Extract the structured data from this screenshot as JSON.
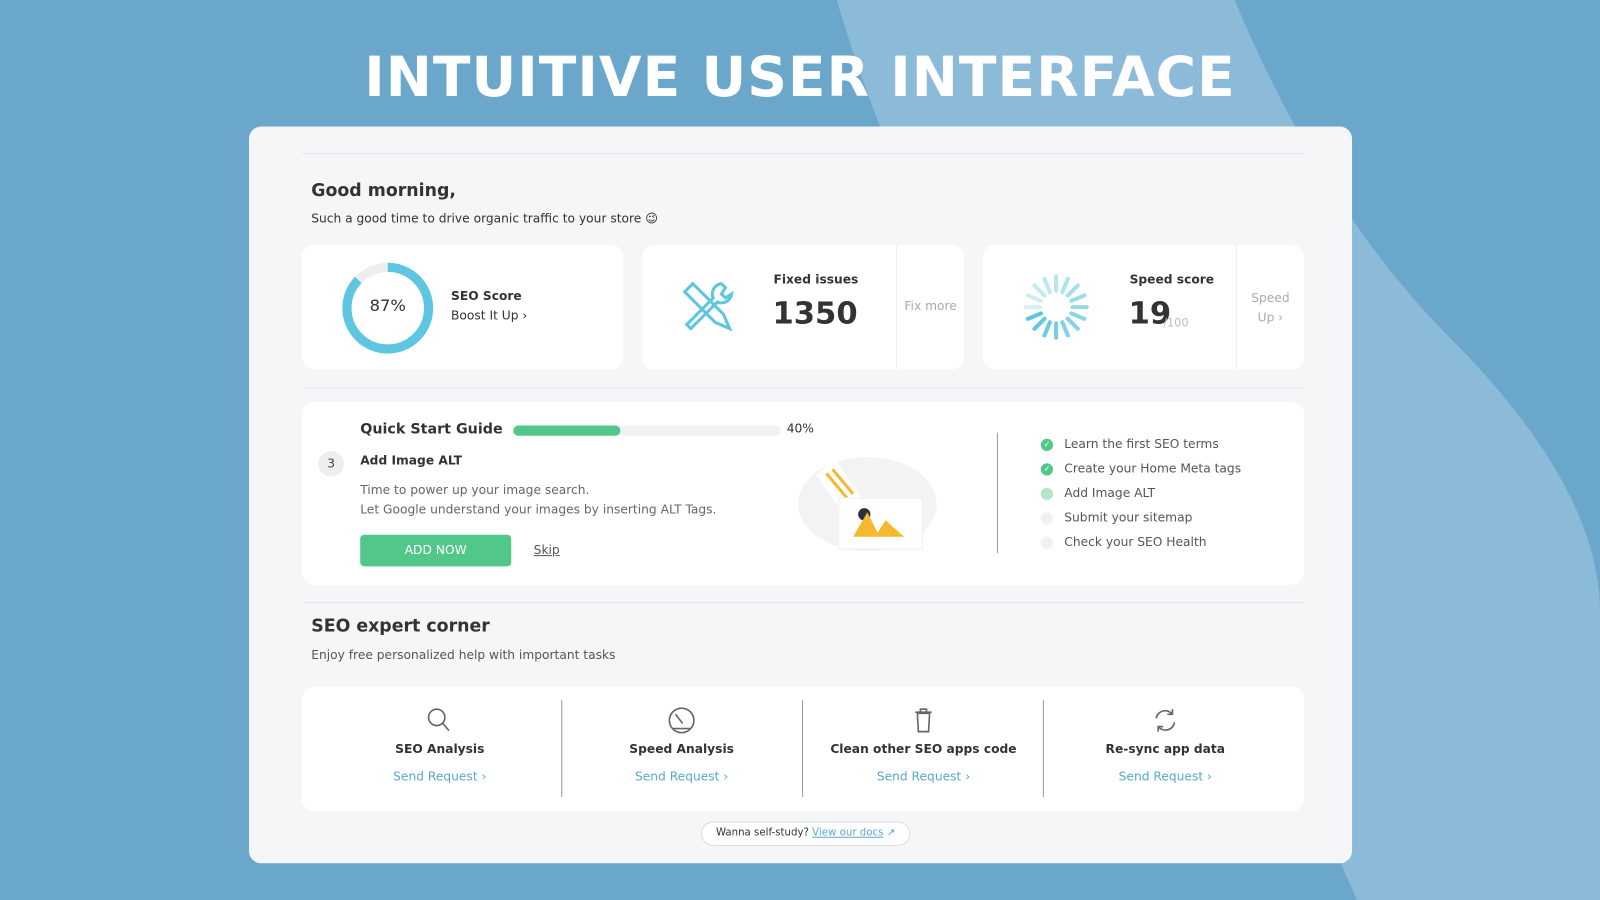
{
  "headline": "INTUITIVE USER INTERFACE",
  "greeting": {
    "title": "Good morning,",
    "subtitle": "Such a good time to drive organic traffic to your store 😉"
  },
  "seo_score": {
    "value": "87%",
    "percent": 87,
    "label": "SEO Score",
    "link": "Boost It Up ›"
  },
  "fixed_issues": {
    "label": "Fixed issues",
    "value": "1350",
    "action": "Fix more"
  },
  "speed_score": {
    "label": "Speed score",
    "value": "19",
    "max": "/100",
    "action_line1": "Speed",
    "action_line2": "Up ›"
  },
  "quick_start": {
    "title": "Quick Start Guide",
    "progress_label": "40%",
    "progress": 40,
    "step_number": "3",
    "step_title": "Add Image ALT",
    "desc_line1": "Time to power up your image search.",
    "desc_line2": "Let Google understand your images by inserting ALT Tags.",
    "add_button": "ADD NOW",
    "skip": "Skip",
    "checklist": [
      {
        "label": "Learn the first SEO terms",
        "status": "done"
      },
      {
        "label": "Create your Home Meta tags",
        "status": "done"
      },
      {
        "label": "Add Image ALT",
        "status": "current"
      },
      {
        "label": "Submit your sitemap",
        "status": "todo"
      },
      {
        "label": "Check your SEO Health",
        "status": "todo"
      }
    ]
  },
  "expert": {
    "title": "SEO expert corner",
    "subtitle": "Enjoy free personalized help with important tasks",
    "items": [
      {
        "icon": "search-icon",
        "label": "SEO Analysis",
        "link": "Send Request ›"
      },
      {
        "icon": "speedometer-icon",
        "label": "Speed Analysis",
        "link": "Send Request ›"
      },
      {
        "icon": "trash-icon",
        "label": "Clean other SEO apps code",
        "link": "Send Request ›"
      },
      {
        "icon": "sync-icon",
        "label": "Re-sync app data",
        "link": "Send Request ›"
      }
    ]
  },
  "footer": {
    "text": "Wanna self-study?",
    "link": "View our docs"
  },
  "colors": {
    "accent": "#5ec6e0",
    "green": "#52c78a",
    "background": "#6aa7cb"
  }
}
